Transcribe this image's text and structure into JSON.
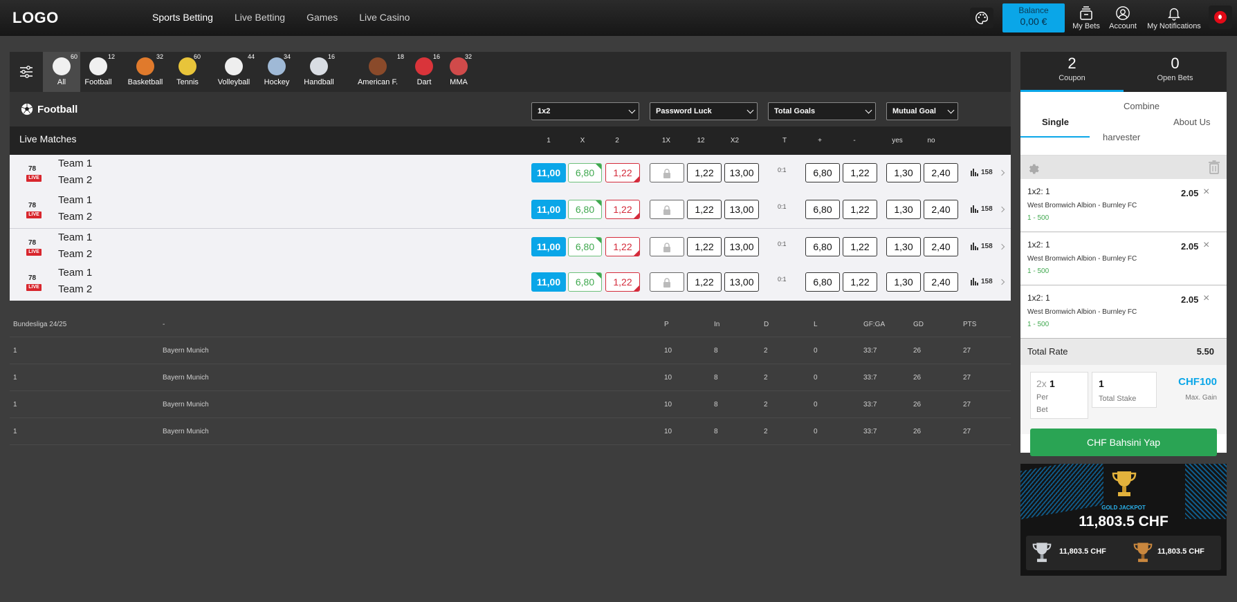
{
  "header": {
    "logo": "LOGO",
    "nav": [
      "Sports Betting",
      "Live Betting",
      "Games",
      "Live Casino"
    ],
    "balance_label": "Balance",
    "balance_value": "0,00 €",
    "my_bets": "My Bets",
    "account": "Account",
    "notifications": "My Notifications"
  },
  "sports": [
    {
      "name": "All",
      "count": "60",
      "color": "#f0f0f0",
      "icon": "soccer-ball-icon"
    },
    {
      "name": "Football",
      "count": "12",
      "color": "#f0f0f0",
      "icon": "soccer-ball-icon"
    },
    {
      "name": "Basketball",
      "count": "32",
      "color": "#e07a2c",
      "icon": "basketball-icon"
    },
    {
      "name": "Tennis",
      "count": "60",
      "color": "#e8c43a",
      "icon": "tennis-ball-icon"
    },
    {
      "name": "Volleyball",
      "count": "44",
      "color": "#eeeeee",
      "icon": "volleyball-icon"
    },
    {
      "name": "Hockey",
      "count": "34",
      "color": "#9fb9d6",
      "icon": "hockey-stick-icon"
    },
    {
      "name": "Handball",
      "count": "16",
      "color": "#d9dde3",
      "icon": "handball-icon"
    },
    {
      "name": "American F.",
      "count": "18",
      "color": "#8a4a2a",
      "icon": "american-football-icon"
    },
    {
      "name": "Dart",
      "count": "16",
      "color": "#d9343a",
      "icon": "dart-icon"
    },
    {
      "name": "MMA",
      "count": "32",
      "color": "#d04a4a",
      "icon": "boxing-glove-icon"
    }
  ],
  "section": {
    "title": "Football",
    "selects": [
      "1x2",
      "Password Luck",
      "Total Goals",
      "Mutual Goal"
    ],
    "live_title": "Live Matches",
    "cols": [
      "1",
      "X",
      "2",
      "1X",
      "12",
      "X2",
      "T",
      "+",
      "-",
      "yes",
      "no"
    ]
  },
  "matches": [
    {
      "minute": "78",
      "live": "LIVE",
      "team1": "Team 1",
      "team2": "Team 2",
      "o1": "11,00",
      "ox": "6,80",
      "o2": "1,22",
      "o12": "1,22",
      "ox2": "13,00",
      "score": "0:1",
      "plus": "6,80",
      "minus": "1,22",
      "yes": "1,30",
      "no": "2,40",
      "stats": "158"
    },
    {
      "minute": "78",
      "live": "LIVE",
      "team1": "Team 1",
      "team2": "Team 2",
      "o1": "11,00",
      "ox": "6,80",
      "o2": "1,22",
      "o12": "1,22",
      "ox2": "13,00",
      "score": "0:1",
      "plus": "6,80",
      "minus": "1,22",
      "yes": "1,30",
      "no": "2,40",
      "stats": "158"
    },
    {
      "minute": "78",
      "live": "LIVE",
      "team1": "Team 1",
      "team2": "Team 2",
      "o1": "11,00",
      "ox": "6,80",
      "o2": "1,22",
      "o12": "1,22",
      "ox2": "13,00",
      "score": "0:1",
      "plus": "6,80",
      "minus": "1,22",
      "yes": "1,30",
      "no": "2,40",
      "stats": "158"
    },
    {
      "minute": "78",
      "live": "LIVE",
      "team1": "Team 1",
      "team2": "Team 2",
      "o1": "11,00",
      "ox": "6,80",
      "o2": "1,22",
      "o12": "1,22",
      "ox2": "13,00",
      "score": "0:1",
      "plus": "6,80",
      "minus": "1,22",
      "yes": "1,30",
      "no": "2,40",
      "stats": "158"
    }
  ],
  "standings": {
    "headers": [
      "Bundesliga 24/25",
      "-",
      "P",
      "In",
      "D",
      "L",
      "GF:GA",
      "GD",
      "PTS"
    ],
    "rows": [
      [
        "1",
        "Bayern Munich",
        "10",
        "8",
        "2",
        "0",
        "33:7",
        "26",
        "27"
      ],
      [
        "1",
        "Bayern Munich",
        "10",
        "8",
        "2",
        "0",
        "33:7",
        "26",
        "27"
      ],
      [
        "1",
        "Bayern Munich",
        "10",
        "8",
        "2",
        "0",
        "33:7",
        "26",
        "27"
      ],
      [
        "1",
        "Bayern Munich",
        "10",
        "8",
        "2",
        "0",
        "33:7",
        "26",
        "27"
      ]
    ]
  },
  "coupon": {
    "coupon_count": "2",
    "coupon_label": "Coupon",
    "open_count": "0",
    "open_label": "Open Bets",
    "modes": {
      "single": "Single",
      "combine": "Combine",
      "harvester": "harvester",
      "about": "About Us"
    },
    "selections": [
      {
        "market": "1x2: 1",
        "event": "West Bromwich Albion - Burnley FC",
        "range": "1 - 500",
        "odd": "2.05"
      },
      {
        "market": "1x2: 1",
        "event": "West Bromwich Albion - Burnley FC",
        "range": "1 - 500",
        "odd": "2.05"
      },
      {
        "market": "1x2: 1",
        "event": "West Bromwich Albion - Burnley FC",
        "range": "1 - 500",
        "odd": "2.05"
      }
    ],
    "total_label": "Total Rate",
    "total_value": "5.50",
    "per_bet_prefix": "2x",
    "per_bet_value": "1",
    "per_bet_label1": "Per",
    "per_bet_label2": "Bet",
    "total_stake_value": "1",
    "total_stake_label": "Total Stake",
    "max_gain_value": "CHF100",
    "max_gain_label": "Max. Gain",
    "cta": "CHF Bahsini Yap"
  },
  "jackpot": {
    "label": "GOLD JACKPOT",
    "value": "11,803.5 CHF",
    "silver": "11,803.5 CHF",
    "bronze": "11,803.5 CHF"
  },
  "colors": {
    "accent": "#0aa6e8",
    "up": "#3fa84e",
    "down": "#d42a3a",
    "cta": "#2aa454"
  }
}
